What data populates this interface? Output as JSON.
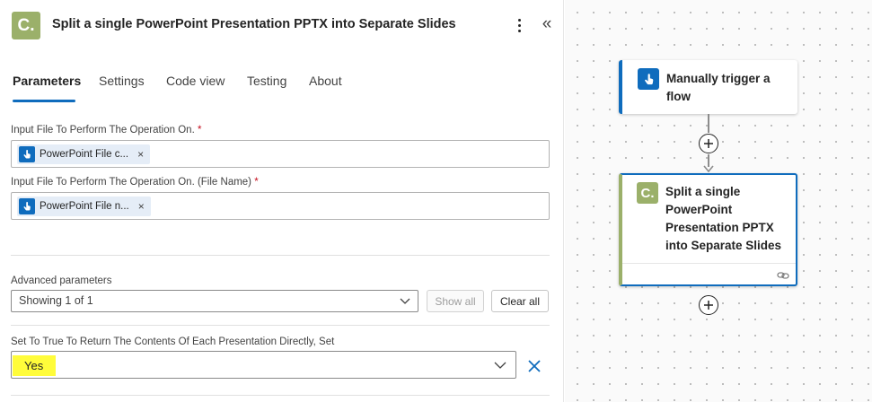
{
  "header": {
    "title": "Split a single PowerPoint Presentation PPTX into Separate Slides",
    "app_icon_letter": "C."
  },
  "tabs": [
    {
      "label": "Parameters",
      "active": true
    },
    {
      "label": "Settings"
    },
    {
      "label": "Code view"
    },
    {
      "label": "Testing"
    },
    {
      "label": "About"
    }
  ],
  "fields": {
    "input_file": {
      "label": "Input File To Perform The Operation On.",
      "required_mark": "*",
      "token": "PowerPoint File c...",
      "token_remove": "×"
    },
    "input_file_name": {
      "label": "Input File To Perform The Operation On. (File Name)",
      "required_mark": "*",
      "token": "PowerPoint File n...",
      "token_remove": "×"
    }
  },
  "advanced": {
    "label": "Advanced parameters",
    "select_value": "Showing 1 of 1",
    "show_all_label": "Show all",
    "clear_all_label": "Clear all"
  },
  "return_contents": {
    "label": "Set To True To Return The Contents Of Each Presentation Directly, Set",
    "value": "Yes"
  },
  "canvas": {
    "trigger_card_title": "Manually trigger a flow",
    "action_card_title": "Split a single PowerPoint Presentation PPTX into Separate Slides",
    "action_icon_letter": "C."
  },
  "colors": {
    "accent": "#0f6cbd",
    "connector_brand": "#9bb06a",
    "highlight": "#fffc3a",
    "required": "#c50f1f"
  },
  "icons": {
    "trigger": "touch-hand-icon",
    "more": "more-vertical-icon",
    "collapse": "double-chevron-left-icon",
    "dropdown": "chevron-down-icon",
    "remove": "close-icon",
    "add": "plus-icon",
    "link": "link-icon"
  }
}
